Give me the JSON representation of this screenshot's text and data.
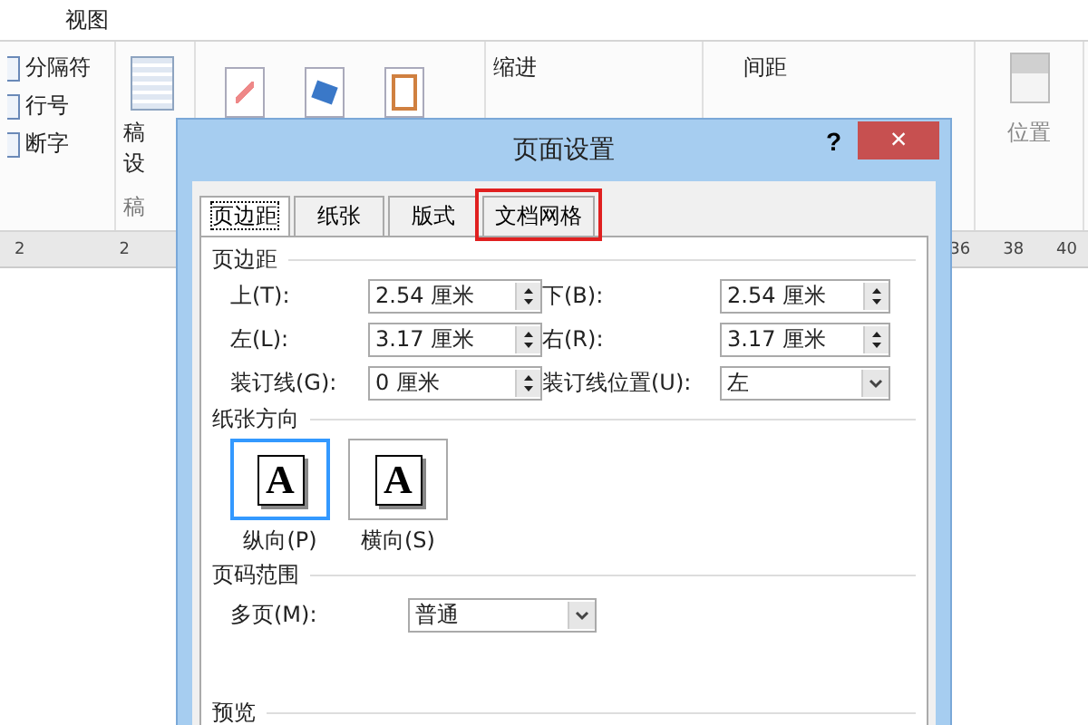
{
  "ribbon": {
    "tabs": [
      "视图"
    ],
    "page_setup_items": [
      {
        "label": "分隔符"
      },
      {
        "label": "行号"
      },
      {
        "label": "断字"
      }
    ],
    "draft_button": {
      "line_1": "稿",
      "line_2": "设"
    },
    "draft_group_label": "稿",
    "indent_label": "缩进",
    "spacing_label": "间距",
    "position_label": "位置"
  },
  "ruler": {
    "left_marks": [
      "2",
      "2"
    ],
    "right_marks": [
      "36",
      "38",
      "40"
    ]
  },
  "dialog": {
    "title": "页面设置",
    "help": "?",
    "close": "×",
    "tabs": [
      {
        "label": "页边距",
        "selected": true,
        "highlighted": false
      },
      {
        "label": "纸张",
        "selected": false,
        "highlighted": false
      },
      {
        "label": "版式",
        "selected": false,
        "highlighted": false
      },
      {
        "label": "文档网格",
        "selected": false,
        "highlighted": true
      }
    ],
    "margins_title": "页边距",
    "margin_rows": [
      {
        "label": "上(T):",
        "value": "2.54 厘米",
        "kind": "spin"
      },
      {
        "label": "下(B):",
        "value": "2.54 厘米",
        "kind": "spin"
      },
      {
        "label": "左(L):",
        "value": "3.17 厘米",
        "kind": "spin"
      },
      {
        "label": "右(R):",
        "value": "3.17 厘米",
        "kind": "spin"
      },
      {
        "label": "装订线(G):",
        "value": "0 厘米",
        "kind": "spin"
      },
      {
        "label": "装订线位置(U):",
        "value": "左",
        "kind": "select"
      }
    ],
    "orientation_title": "纸张方向",
    "orientations": [
      {
        "label": "纵向(P)",
        "glyph": "A",
        "selected": true
      },
      {
        "label": "横向(S)",
        "glyph": "A",
        "selected": false
      }
    ],
    "pages_title": "页码范围",
    "multiple_pages_label": "多页(M):",
    "multiple_pages_value": "普通",
    "preview_title": "预览"
  }
}
